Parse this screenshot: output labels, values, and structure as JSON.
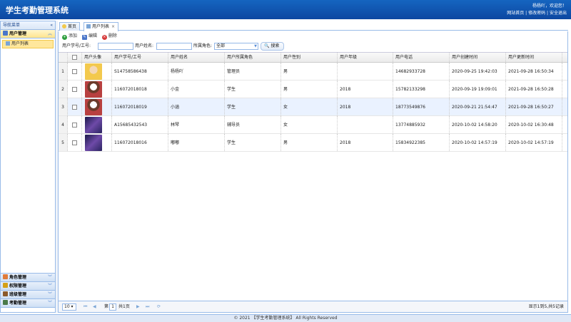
{
  "header": {
    "title": "学生考勤管理系统",
    "welcome": "杨杨吖，欢迎您！",
    "links": [
      "网站首页",
      "修改密码",
      "安全退出"
    ],
    "separator": "|"
  },
  "sidebar": {
    "title": "导航菜单",
    "collapse_icon": "«",
    "active_section": "用户管理",
    "active_items": [
      "用户列表"
    ],
    "sections": [
      {
        "label": "角色管理",
        "icon": "role-icon",
        "color": "#e07b39"
      },
      {
        "label": "权限管理",
        "icon": "key-icon",
        "color": "#d4a017"
      },
      {
        "label": "班级管理",
        "icon": "class-icon",
        "color": "#8b5a2b"
      },
      {
        "label": "考勤管理",
        "icon": "attendance-icon",
        "color": "#4a7a4a"
      }
    ],
    "up_chevron": "︽",
    "down_chevron": "︾"
  },
  "tabs": [
    {
      "label": "首页",
      "icon": "bulb-icon"
    },
    {
      "label": "用户列表",
      "icon": "page-icon",
      "close": "×"
    }
  ],
  "toolbar": {
    "add": "添加",
    "edit": "编辑",
    "delete": "删除",
    "colors": {
      "add": "#2e9e3e",
      "edit": "#4a76c9",
      "delete": "#d63a3a"
    }
  },
  "search": {
    "id_label": "用户学号/工号:",
    "name_label": "用户姓名:",
    "role_label": "所属角色:",
    "role_value": "全部",
    "button": "搜索"
  },
  "grid": {
    "columns": [
      "用户头像",
      "用户学号/工号",
      "用户姓名",
      "用户所属角色",
      "用户性别",
      "用户年级",
      "用户电话",
      "用户创建时间",
      "用户更新时间"
    ],
    "rows": [
      {
        "num": "1",
        "avatar": "a",
        "id": "S14758586438",
        "name": "杨杨吖",
        "role": "管理员",
        "gender": "男",
        "grade": "",
        "phone": "14682933728",
        "created": "2020-09-25 19:42:03",
        "updated": "2021-09-28 16:50:34"
      },
      {
        "num": "2",
        "avatar": "b",
        "id": "116072018018",
        "name": "小金",
        "role": "学生",
        "gender": "男",
        "grade": "2018",
        "phone": "15782133298",
        "created": "2020-09-19 19:09:01",
        "updated": "2021-09-28 16:50:28"
      },
      {
        "num": "3",
        "avatar": "b",
        "id": "116072018019",
        "name": "小涵",
        "role": "学生",
        "gender": "女",
        "grade": "2018",
        "phone": "18773549876",
        "created": "2020-09-21 21:54:47",
        "updated": "2021-09-28 16:50:27"
      },
      {
        "num": "4",
        "avatar": "c",
        "id": "A15685432543",
        "name": "林琴",
        "role": "辅导员",
        "gender": "女",
        "grade": "",
        "phone": "13774885932",
        "created": "2020-10-02 14:58:20",
        "updated": "2020-10-02 16:30:48"
      },
      {
        "num": "5",
        "avatar": "c",
        "id": "116072018016",
        "name": "嘟嘟",
        "role": "学生",
        "gender": "男",
        "grade": "2018",
        "phone": "15834922385",
        "created": "2020-10-02 14:57:19",
        "updated": "2020-10-02 14:57:19"
      }
    ],
    "selected_row": 2
  },
  "pager": {
    "page_size": "10",
    "page_prefix": "第",
    "page": "1",
    "page_suffix": "共1页",
    "info": "显示1到5,共5记录",
    "first": "⏮",
    "prev": "◀",
    "next": "▶",
    "last": "⏭",
    "refresh": "⟳"
  },
  "footer": "© 2021 【学生考勤管理系统】 All Rights Reserved"
}
